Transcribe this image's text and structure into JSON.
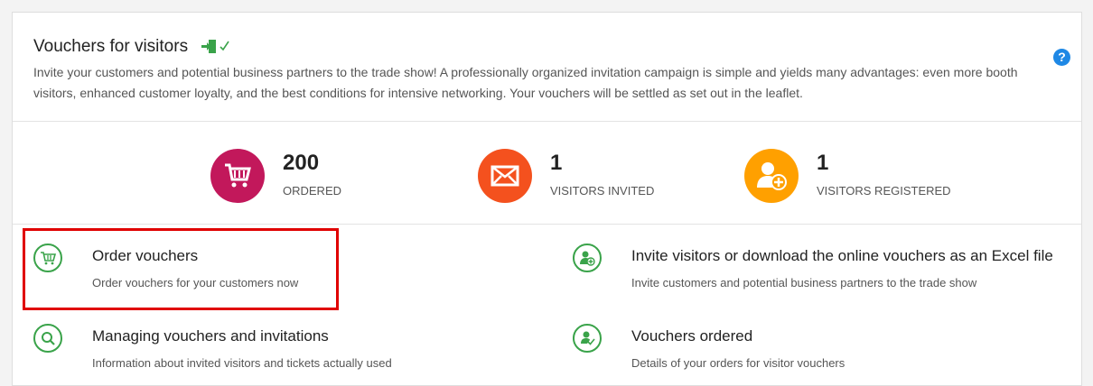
{
  "header": {
    "title": "Vouchers for visitors",
    "description": "Invite your customers and potential business partners to the trade show! A professionally organized invitation campaign is simple and yields many advantages: even more booth visitors, enhanced customer loyalty, and the best conditions for intensive networking. Your vouchers will be settled as set out in the leaflet.",
    "help_label": "?"
  },
  "stats": [
    {
      "value": "200",
      "label": "ORDERED",
      "icon": "cart-icon",
      "color": "#c2185b"
    },
    {
      "value": "1",
      "label": "VISITORS INVITED",
      "icon": "envelope-icon",
      "color": "#f4511e"
    },
    {
      "value": "1",
      "label": "VISITORS REGISTERED",
      "icon": "user-add-icon",
      "color": "#ffa000"
    }
  ],
  "actions": [
    {
      "title": "Order vouchers",
      "subtitle": "Order vouchers for your customers now",
      "icon": "cart-icon"
    },
    {
      "title": "Invite visitors or download the online vouchers as an Excel file",
      "subtitle": "Invite customers and potential business partners to the trade show",
      "icon": "user-add-icon"
    },
    {
      "title": "Managing vouchers and invitations",
      "subtitle": "Information about invited visitors and tickets actually used",
      "icon": "search-icon"
    },
    {
      "title": "Vouchers ordered",
      "subtitle": "Details of your orders for visitor vouchers",
      "icon": "user-check-icon"
    }
  ],
  "colors": {
    "accent_green": "#3aa34a",
    "help_blue": "#1e88e5",
    "highlight_red": "#e00000"
  }
}
